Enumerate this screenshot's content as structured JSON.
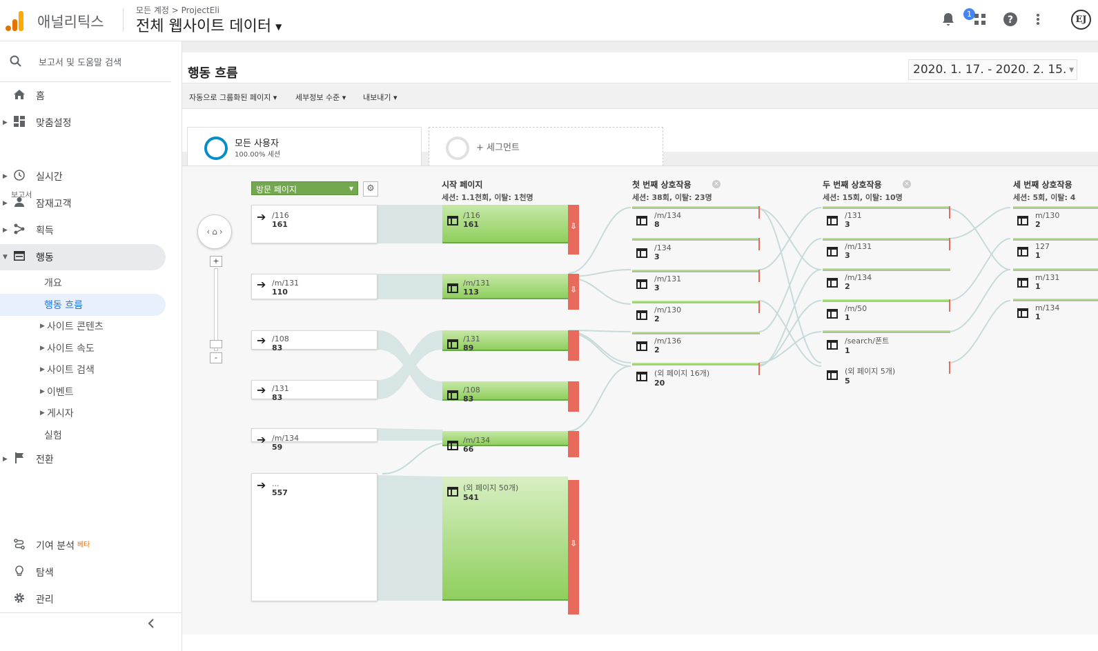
{
  "app": {
    "name": "애널리틱스",
    "breadcrumb": "모든 계정 > ProjectEli",
    "property": "전체 웹사이트 데이터",
    "notification_count": "1",
    "avatar_initials": "EJ"
  },
  "sidebar": {
    "search_placeholder": "보고서 및 도움말 검색",
    "section_label": "보고서",
    "items": [
      {
        "label": "홈",
        "icon": "home-icon"
      },
      {
        "label": "맞춤설정",
        "icon": "dashboard-icon"
      },
      {
        "label": "실시간",
        "icon": "clock-icon"
      },
      {
        "label": "잠재고객",
        "icon": "person-icon"
      },
      {
        "label": "획득",
        "icon": "acquisition-icon"
      },
      {
        "label": "행동",
        "icon": "behavior-icon"
      },
      {
        "label": "전환",
        "icon": "flag-icon"
      }
    ],
    "behavior_sub": [
      "개요",
      "행동 흐름",
      "사이트 콘텐츠",
      "사이트 속도",
      "사이트 검색",
      "이벤트",
      "게시자",
      "실험"
    ],
    "bottom": [
      {
        "label": "기여 분석",
        "badge": "베타",
        "icon": "attribution-icon"
      },
      {
        "label": "탐색",
        "icon": "lightbulb-icon"
      },
      {
        "label": "관리",
        "icon": "gear-icon"
      }
    ]
  },
  "report": {
    "title": "행동 흐름",
    "date_range": "2020. 1. 17. - 2020. 2. 15.",
    "toolbar": [
      "자동으로 그룹화된 페이지",
      "세부정보 수준",
      "내보내기"
    ],
    "segments": [
      {
        "name": "모든 사용자",
        "pct": "100.00% 세션"
      },
      {
        "name": "+ 세그먼트"
      }
    ]
  },
  "flow": {
    "dimension_select": "방문 페이지",
    "columns": [
      {
        "title": "시작 페이지",
        "sub": "세션: 1.1천회, 이탈: 1천명"
      },
      {
        "title": "첫 번째 상호작용",
        "sub": "세션: 38회, 이탈: 23명"
      },
      {
        "title": "두 번째 상호작용",
        "sub": "세션: 15회, 이탈: 10명"
      },
      {
        "title": "세 번째 상호작용",
        "sub": "세션: 5회, 이탈: 4"
      }
    ],
    "landing": [
      {
        "page": "/116",
        "value": "161"
      },
      {
        "page": "/m/131",
        "value": "110"
      },
      {
        "page": "/108",
        "value": "83"
      },
      {
        "page": "/131",
        "value": "83"
      },
      {
        "page": "/m/134",
        "value": "59"
      },
      {
        "page": "...",
        "value": "557"
      }
    ],
    "start": [
      {
        "page": "/116",
        "value": "161"
      },
      {
        "page": "/m/131",
        "value": "113"
      },
      {
        "page": "/131",
        "value": "89"
      },
      {
        "page": "/108",
        "value": "83"
      },
      {
        "page": "/m/134",
        "value": "66"
      },
      {
        "page": "(외 페이지 50개)",
        "value": "541"
      }
    ],
    "first": [
      {
        "page": "/m/134",
        "value": "8"
      },
      {
        "page": "/134",
        "value": "3"
      },
      {
        "page": "/m/131",
        "value": "3"
      },
      {
        "page": "/m/130",
        "value": "2"
      },
      {
        "page": "/m/136",
        "value": "2"
      },
      {
        "page": "(외 페이지 16개)",
        "value": "20"
      }
    ],
    "second": [
      {
        "page": "/131",
        "value": "3"
      },
      {
        "page": "/m/131",
        "value": "3"
      },
      {
        "page": "/m/134",
        "value": "2"
      },
      {
        "page": "/m/50",
        "value": "1"
      },
      {
        "page": "/search/폰트",
        "value": "1"
      },
      {
        "page": "(외 페이지 5개)",
        "value": "5"
      }
    ],
    "third": [
      {
        "page": "m/130",
        "value": "2"
      },
      {
        "page": "127",
        "value": "1"
      },
      {
        "page": "m/131",
        "value": "1"
      },
      {
        "page": "m/134",
        "value": "1"
      }
    ]
  }
}
